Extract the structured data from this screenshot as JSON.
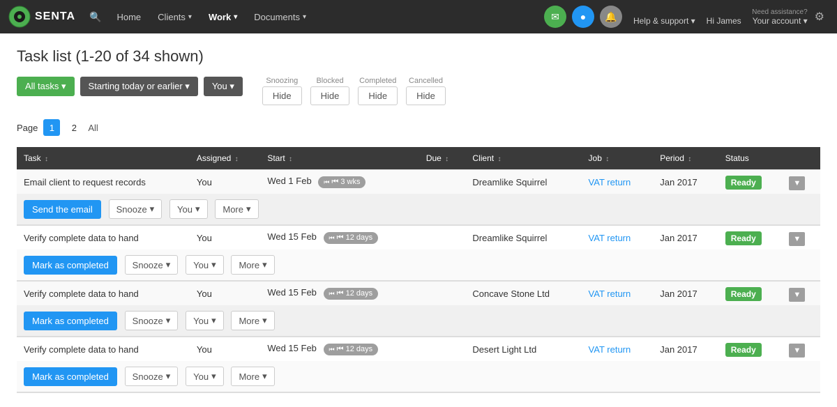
{
  "app": {
    "logo_text": "SENTA",
    "nav_items": [
      {
        "label": "Home",
        "active": false
      },
      {
        "label": "Clients",
        "active": false,
        "has_caret": true
      },
      {
        "label": "Work",
        "active": true,
        "has_caret": true
      },
      {
        "label": "Documents",
        "active": false,
        "has_caret": true
      }
    ],
    "nav_icons": [
      {
        "type": "green",
        "symbol": "✉"
      },
      {
        "type": "blue",
        "symbol": "●"
      },
      {
        "type": "gray",
        "symbol": "🔔"
      }
    ],
    "need_assistance": "Need assistance?",
    "help_label": "Help & support ▾",
    "account_label": "Your account ▾",
    "hi_label": "Hi James"
  },
  "page": {
    "title": "Task list (1-20 of 34 shown)"
  },
  "filters": {
    "all_tasks_label": "All tasks ▾",
    "starting_today_label": "Starting today or earlier ▾",
    "you_label": "You ▾",
    "snoozing_label": "Snoozing",
    "blocked_label": "Blocked",
    "completed_label": "Completed",
    "cancelled_label": "Cancelled",
    "hide_label": "Hide"
  },
  "pagination": {
    "label": "Page",
    "pages": [
      "1",
      "2",
      "All"
    ],
    "active_page": "1"
  },
  "table": {
    "columns": [
      {
        "label": "Task",
        "sort": "↕"
      },
      {
        "label": "Assigned",
        "sort": "↕"
      },
      {
        "label": "Start",
        "sort": "↕"
      },
      {
        "label": "Due",
        "sort": "↕"
      },
      {
        "label": "Client",
        "sort": "↕"
      },
      {
        "label": "Job",
        "sort": "↕"
      },
      {
        "label": "Period",
        "sort": "↕"
      },
      {
        "label": "Status"
      }
    ],
    "rows": [
      {
        "id": 1,
        "task": "Email client to request records",
        "assigned": "You",
        "start": "Wed 1 Feb",
        "start_badge": "⏮ 3 wks",
        "due": "",
        "client": "Dreamlike Squirrel",
        "job": "VAT return",
        "period": "Jan 2017",
        "status": "Ready",
        "primary_action": "Send the email",
        "primary_type": "blue"
      },
      {
        "id": 2,
        "task": "Verify complete data to hand",
        "assigned": "You",
        "start": "Wed 15 Feb",
        "start_badge": "⏮ 12 days",
        "due": "",
        "client": "Dreamlike Squirrel",
        "job": "VAT return",
        "period": "Jan 2017",
        "status": "Ready",
        "primary_action": "Mark as completed",
        "primary_type": "blue"
      },
      {
        "id": 3,
        "task": "Verify complete data to hand",
        "assigned": "You",
        "start": "Wed 15 Feb",
        "start_badge": "⏮ 12 days",
        "due": "",
        "client": "Concave Stone Ltd",
        "job": "VAT return",
        "period": "Jan 2017",
        "status": "Ready",
        "primary_action": "Mark as completed",
        "primary_type": "blue"
      },
      {
        "id": 4,
        "task": "Verify complete data to hand",
        "assigned": "You",
        "start": "Wed 15 Feb",
        "start_badge": "⏮ 12 days",
        "due": "",
        "client": "Desert Light Ltd",
        "job": "VAT return",
        "period": "Jan 2017",
        "status": "Ready",
        "primary_action": "Mark as completed",
        "primary_type": "blue"
      }
    ]
  }
}
